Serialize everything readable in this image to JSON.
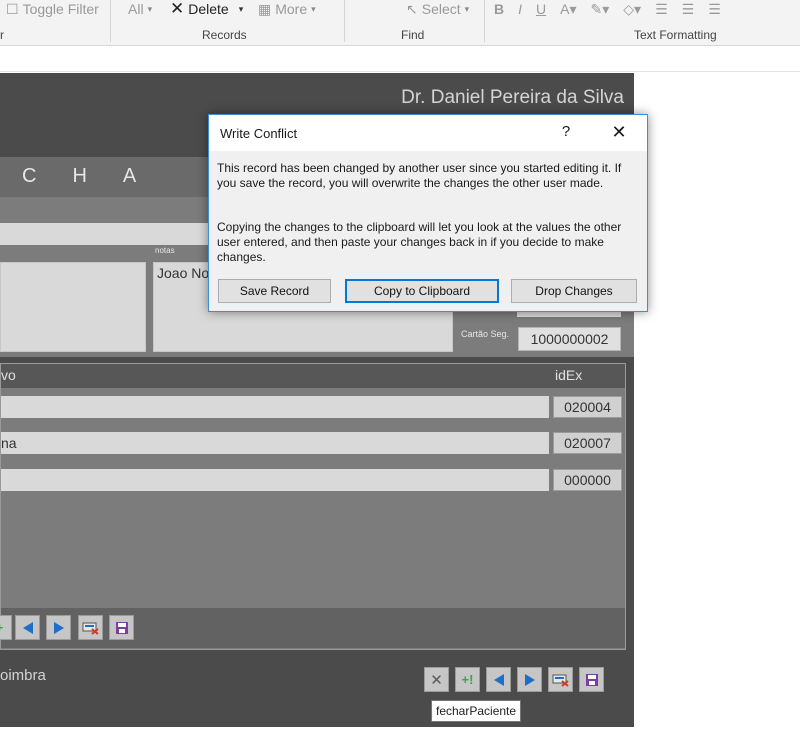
{
  "ribbon": {
    "toggle_filter": "Toggle Filter",
    "all": "All",
    "delete": "Delete",
    "more": "More",
    "select": "Select",
    "groups": {
      "sort_filter_tail": "r",
      "records": "Records",
      "find": "Find",
      "text_formatting": "Text Formatting"
    }
  },
  "form": {
    "doctor_name": "Dr. Daniel Pereira da Silva",
    "banner_letters": [
      "C",
      "H",
      "A"
    ],
    "notes_label": "notas",
    "notes_value": "Joao No",
    "cartao_label": "Cartão Seg.",
    "cartao_value": "1000000002",
    "grid": {
      "col_desc": "vo",
      "col_idex": "idEx",
      "rows": [
        {
          "desc": "",
          "idex": "020004"
        },
        {
          "desc": "na",
          "idex": "020007"
        },
        {
          "desc": "",
          "idex": "000000"
        }
      ]
    },
    "city": "oimbra",
    "tooltip": "fecharPaciente"
  },
  "dialog": {
    "title": "Write Conflict",
    "help": "?",
    "close": "✕",
    "message1": "This record has been changed by another user since you started editing it.  If you save the record, you will overwrite the changes the other user made.",
    "message2": "Copying the changes to the clipboard will let you look at the values the other user entered, and then paste your changes back in if you decide to make changes.",
    "buttons": {
      "save": "Save Record",
      "copy": "Copy to Clipboard",
      "drop": "Drop Changes"
    }
  },
  "colors": {
    "accent": "#0078d7",
    "form_bg": "#4b4b4b",
    "panel_bg": "#7c7c7c",
    "nav_blue": "#1f6fc9",
    "save_purple": "#7a3fa0",
    "add_green": "#3aa547",
    "delete_red": "#d03a2b"
  }
}
